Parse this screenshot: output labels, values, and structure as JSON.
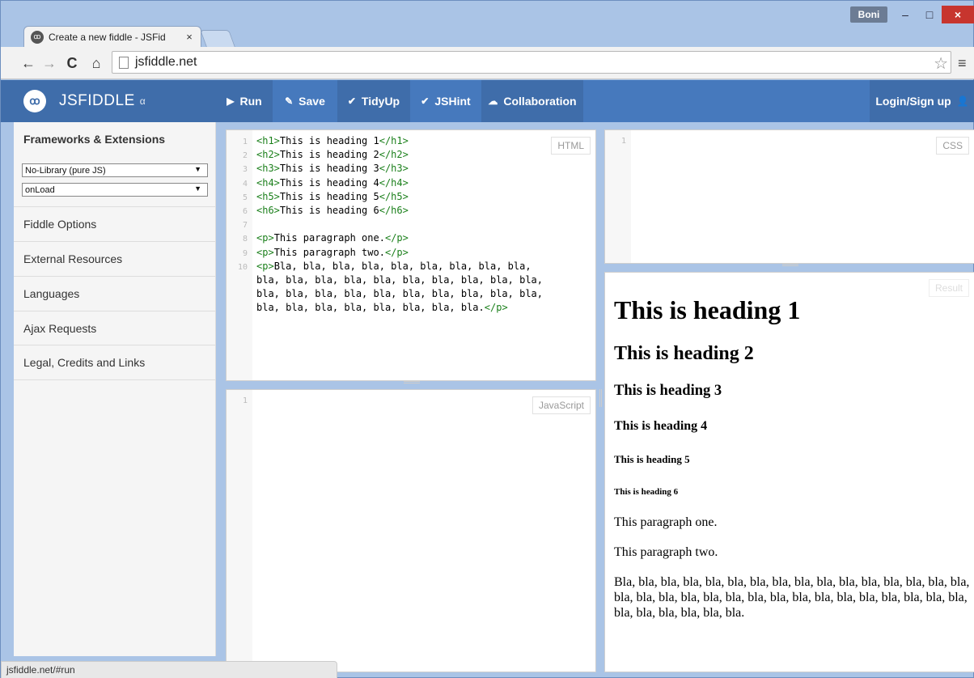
{
  "browser": {
    "tab_title": "Create a new fiddle - JSFid",
    "tab_close": "×",
    "user": "Boni",
    "url": "jsfiddle.net",
    "status_url": "jsfiddle.net/#run",
    "icons": {
      "back": "←",
      "forward": "→",
      "reload": "C",
      "home": "⌂",
      "star": "☆",
      "menu": "≡",
      "minimize": "–",
      "maximize": "□",
      "close": "×"
    }
  },
  "header": {
    "brand": "JSFIDDLE",
    "brand_tag": "α",
    "logo_glyph": "ꝏ",
    "buttons": {
      "run": "Run",
      "save": "Save",
      "tidyup": "TidyUp",
      "jshint": "JSHint",
      "collaboration": "Collaboration",
      "login": "Login/Sign up"
    },
    "icons": {
      "run": "▶",
      "save": "✎",
      "tidyup": "✔",
      "jshint": "✔",
      "collaboration": "☁",
      "login": "👤"
    }
  },
  "sidebar": {
    "title": "Frameworks & Extensions",
    "framework_select": "No-Library (pure JS)",
    "load_select": "onLoad",
    "select_arrow": "▼",
    "items": [
      "Fiddle Options",
      "External Resources",
      "Languages",
      "Ajax Requests",
      "Legal, Credits and Links"
    ]
  },
  "editors": {
    "html_label": "HTML",
    "css_label": "CSS",
    "js_label": "JavaScript",
    "result_label": "Result",
    "html_code": [
      {
        "n": "1",
        "open": "<h1>",
        "text": "This is heading 1",
        "close": "</h1>"
      },
      {
        "n": "2",
        "open": "<h2>",
        "text": "This is heading 2",
        "close": "</h2>"
      },
      {
        "n": "3",
        "open": "<h3>",
        "text": "This is heading 3",
        "close": "</h3>"
      },
      {
        "n": "4",
        "open": "<h4>",
        "text": "This is heading 4",
        "close": "</h4>"
      },
      {
        "n": "5",
        "open": "<h5>",
        "text": "This is heading 5",
        "close": "</h5>"
      },
      {
        "n": "6",
        "open": "<h6>",
        "text": "This is heading 6",
        "close": "</h6>"
      },
      {
        "n": "7",
        "open": "",
        "text": "",
        "close": ""
      },
      {
        "n": "8",
        "open": "<p>",
        "text": "This paragraph one.",
        "close": "</p>"
      },
      {
        "n": "9",
        "open": "<p>",
        "text": "This paragraph two.",
        "close": "</p>"
      },
      {
        "n": "10",
        "open": "<p>",
        "text": "Bla, bla, bla, bla, bla, bla, bla, bla, bla,",
        "close": ""
      },
      {
        "n": "",
        "open": "",
        "text": "bla, bla, bla, bla, bla, bla, bla, bla, bla, bla,",
        "close": ""
      },
      {
        "n": "",
        "open": "",
        "text": "bla, bla, bla, bla, bla, bla, bla, bla, bla, bla,",
        "close": ""
      },
      {
        "n": "",
        "open": "",
        "text": "bla, bla, bla, bla, bla, bla, bla, bla.",
        "close": "</p>"
      }
    ],
    "css_line": "1",
    "js_line": "1"
  },
  "result": {
    "h1": "This is heading 1",
    "h2": "This is heading 2",
    "h3": "This is heading 3",
    "h4": "This is heading 4",
    "h5": "This is heading 5",
    "h6": "This is heading 6",
    "p1": "This paragraph one.",
    "p2": "This paragraph two.",
    "p3": "Bla, bla, bla, bla, bla, bla, bla, bla, bla, bla, bla, bla, bla, bla, bla, bla, bla, bla, bla, bla, bla, bla, bla, bla, bla, bla, bla, bla, bla, bla, bla, bla, bla, bla, bla, bla, bla, bla."
  }
}
